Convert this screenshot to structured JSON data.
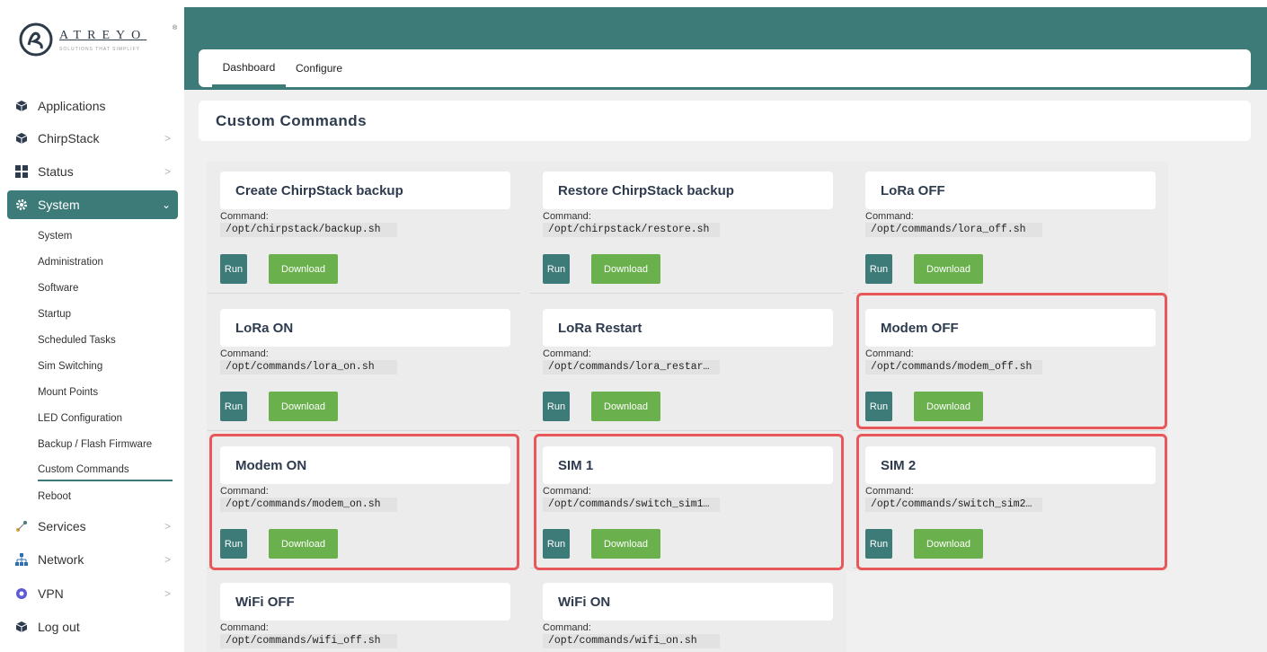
{
  "brand": {
    "name": "ATREYO",
    "tagline": "SOLUTIONS THAT SIMPLIFY",
    "registered": "®"
  },
  "sidebar": {
    "items": [
      {
        "label": "Applications",
        "icon": "cube-icon"
      },
      {
        "label": "ChirpStack",
        "icon": "cube-icon",
        "chevron": ">"
      },
      {
        "label": "Status",
        "icon": "grid-icon",
        "chevron": ">"
      },
      {
        "label": "System",
        "icon": "gear-icon",
        "chevron": "⌄"
      },
      {
        "label": "Services",
        "icon": "nodes-icon",
        "chevron": ">"
      },
      {
        "label": "Network",
        "icon": "network-icon",
        "chevron": ">"
      },
      {
        "label": "VPN",
        "icon": "vpn-icon",
        "chevron": ">"
      },
      {
        "label": "Log out",
        "icon": "cube-icon"
      }
    ],
    "system_sub": [
      "System",
      "Administration",
      "Software",
      "Startup",
      "Scheduled Tasks",
      "Sim Switching",
      "Mount Points",
      "LED Configuration",
      "Backup / Flash Firmware",
      "Custom Commands",
      "Reboot"
    ]
  },
  "tabs": [
    "Dashboard",
    "Configure"
  ],
  "section_title": "Custom Commands",
  "command_label": "Command:",
  "run_label": "Run",
  "download_label": "Download",
  "commands": [
    {
      "title": "Create ChirpStack backup",
      "command": "/opt/chirpstack/backup.sh"
    },
    {
      "title": "Restore ChirpStack backup",
      "command": "/opt/chirpstack/restore.sh"
    },
    {
      "title": "LoRa OFF",
      "command": "/opt/commands/lora_off.sh"
    },
    {
      "title": "LoRa ON",
      "command": "/opt/commands/lora_on.sh"
    },
    {
      "title": "LoRa Restart",
      "command": "/opt/commands/lora_restar…"
    },
    {
      "title": "Modem OFF",
      "command": "/opt/commands/modem_off.sh"
    },
    {
      "title": "Modem ON",
      "command": "/opt/commands/modem_on.sh"
    },
    {
      "title": "SIM 1",
      "command": "/opt/commands/switch_sim1…"
    },
    {
      "title": "SIM 2",
      "command": "/opt/commands/switch_sim2…"
    },
    {
      "title": "WiFi OFF",
      "command": "/opt/commands/wifi_off.sh"
    },
    {
      "title": "WiFi ON",
      "command": "/opt/commands/wifi_on.sh"
    }
  ],
  "colors": {
    "accent": "#3d7b78",
    "download": "#6ab04c",
    "highlight": "#e8585a"
  }
}
